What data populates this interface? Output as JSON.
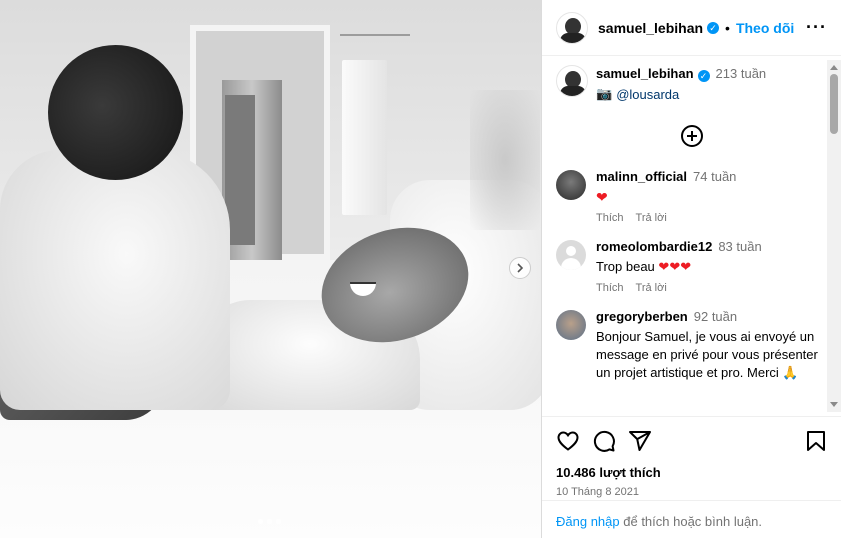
{
  "post": {
    "carousel": {
      "next_icon": "chevron-right-icon",
      "slide_count": 3,
      "active_slide": 1
    }
  },
  "header": {
    "username": "samuel_lebihan",
    "verified_icon": "verified-badge-icon",
    "separator": "•",
    "follow_label": "Theo dõi",
    "more_icon": "more-horizontal-icon"
  },
  "caption": {
    "username": "samuel_lebihan",
    "age": "213 tuần",
    "camera_icon": "camera-icon",
    "mention": "@lousarda"
  },
  "load_more_icon": "plus-circle-icon",
  "comments": [
    {
      "username": "malinn_official",
      "age": "74 tuần",
      "text": "❤",
      "like_label": "Thích",
      "reply_label": "Trả lời"
    },
    {
      "username": "romeolombardie12",
      "age": "83 tuần",
      "text": "Trop beau ❤❤❤",
      "like_label": "Thích",
      "reply_label": "Trả lời"
    },
    {
      "username": "gregoryberben",
      "age": "92 tuần",
      "text": "Bonjour Samuel, je vous ai envoyé un message en privé pour vous présenter un projet artistique et pro. Merci 🙏"
    }
  ],
  "actions": {
    "like_icon": "heart-outline-icon",
    "comment_icon": "comment-icon",
    "share_icon": "send-icon",
    "save_icon": "bookmark-icon"
  },
  "likes": "10.486 lượt thích",
  "date": "10 Tháng 8 2021",
  "login": {
    "link": "Đăng nhập",
    "text": "để thích hoặc bình luận."
  },
  "colors": {
    "accent": "#0095f6",
    "muted": "#737373",
    "heart": "#ed1c24"
  }
}
